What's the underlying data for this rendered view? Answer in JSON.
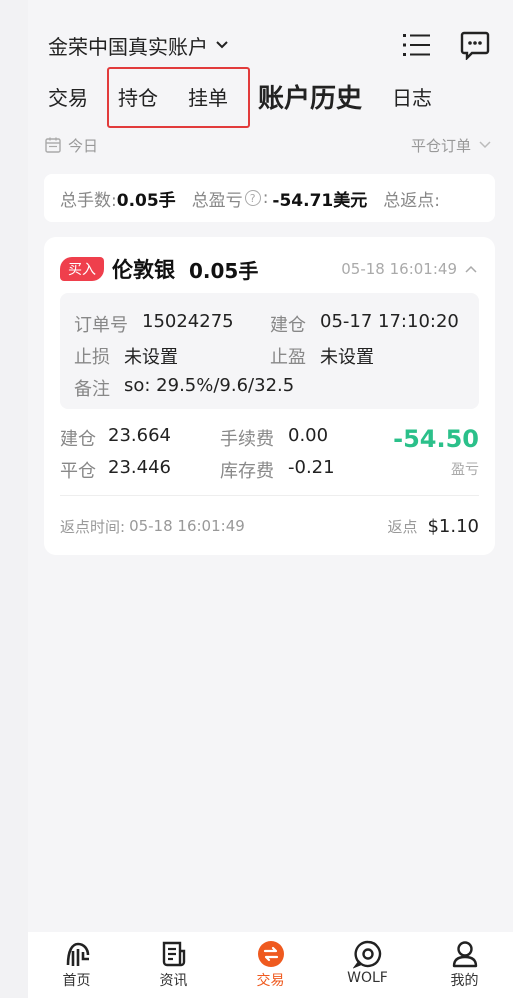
{
  "header": {
    "title": "金荣中国真实账户"
  },
  "tabs": [
    "交易",
    "持仓",
    "挂单",
    "账户历史",
    "日志"
  ],
  "filter": {
    "date_label": "今日",
    "type_label": "平仓订单"
  },
  "summary": {
    "total_lots_label": "总手数:",
    "total_lots_value": "0.05手",
    "total_pnl_label": "总盈亏",
    "total_pnl_value": "-54.71美元",
    "total_rebate_label": "总返点:"
  },
  "order": {
    "side_badge": "买入",
    "symbol": "伦敦银",
    "lots": "0.05手",
    "time": "05-18 16:01:49",
    "order_no_label": "订单号",
    "order_no": "15024275",
    "open_time_label": "建仓",
    "open_time": "05-17 17:10:20",
    "stop_loss_label": "止损",
    "stop_loss": "未设置",
    "take_profit_label": "止盈",
    "take_profit": "未设置",
    "note_label": "备注",
    "note": "so: 29.5%/9.6/32.5",
    "open_price_label": "建仓",
    "open_price": "23.664",
    "fee_label": "手续费",
    "fee": "0.00",
    "close_price_label": "平仓",
    "close_price": "23.446",
    "swap_label": "库存费",
    "swap": "-0.21",
    "pnl": "-54.50",
    "pnl_label": "盈亏",
    "rebate_time_label": "返点时间:",
    "rebate_time": "05-18 16:01:49",
    "rebate_label": "返点",
    "rebate_value": "$1.10"
  },
  "nav": [
    {
      "label": "首页",
      "icon": "home-logo-icon"
    },
    {
      "label": "资讯",
      "icon": "news-icon"
    },
    {
      "label": "交易",
      "icon": "trade-icon"
    },
    {
      "label": "WOLF",
      "icon": "chat-bubble-icon"
    },
    {
      "label": "我的",
      "icon": "profile-icon"
    }
  ],
  "colors": {
    "accent": "#ef5a1f",
    "loss_green": "#2bc08a",
    "badge_red": "#ef3f4c",
    "highlight_red": "#e23b3b"
  }
}
